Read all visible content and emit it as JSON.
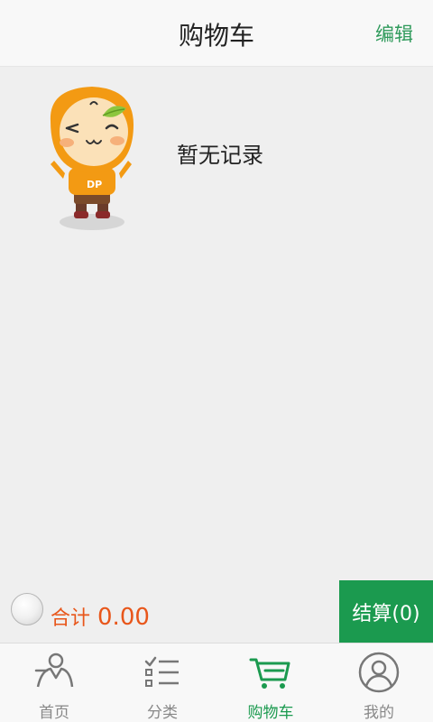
{
  "header": {
    "title": "购物车",
    "edit_label": "编辑"
  },
  "empty_state": {
    "mascot_icon": "dp-mascot-icon",
    "message": "暂无记录"
  },
  "checkout": {
    "total_label": "合计",
    "total_amount": "0.00",
    "button_label": "结算(0)"
  },
  "tabbar": {
    "items": [
      {
        "label": "首页",
        "icon": "home-person-icon",
        "active": false
      },
      {
        "label": "分类",
        "icon": "category-list-icon",
        "active": false
      },
      {
        "label": "购物车",
        "icon": "cart-icon",
        "active": true
      },
      {
        "label": "我的",
        "icon": "profile-icon",
        "active": false
      }
    ]
  },
  "colors": {
    "accent_green": "#1b9a4f",
    "price_orange": "#e8561a",
    "background": "#efefef"
  }
}
